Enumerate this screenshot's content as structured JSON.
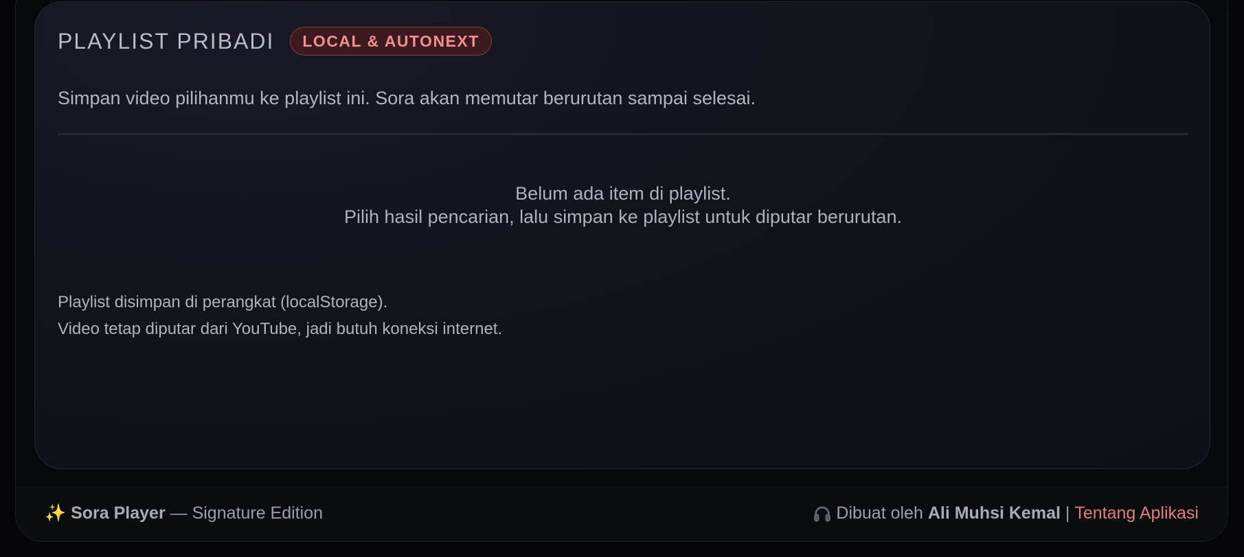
{
  "playlist": {
    "title": "PLAYLIST PRIBADI",
    "badge": "LOCAL & AUTONEXT",
    "description": "Simpan video pilihanmu ke playlist ini. Sora akan memutar berurutan sampai selesai.",
    "empty_line1": "Belum ada item di playlist.",
    "empty_line2": "Pilih hasil pencarian, lalu simpan ke playlist untuk diputar berurutan.",
    "note_line1": "Playlist disimpan di perangkat (localStorage).",
    "note_line2": "Video tetap diputar dari YouTube, jadi butuh koneksi internet."
  },
  "footer": {
    "sparkle_icon": "✨",
    "brand": "Sora Player",
    "edition": " — Signature Edition",
    "made_by": "Dibuat oleh ",
    "author": "Ali Muhsi Kemal",
    "separator": " | ",
    "about_link": "Tentang Aplikasi"
  },
  "icons": {
    "sparkle": "sparkle-icon",
    "headphones": "headphones-icon"
  },
  "colors": {
    "badge_text": "#f48f8f",
    "badge_bg": "#3c1a1e",
    "link": "#e27c7a",
    "card_bg": "#12131b"
  }
}
